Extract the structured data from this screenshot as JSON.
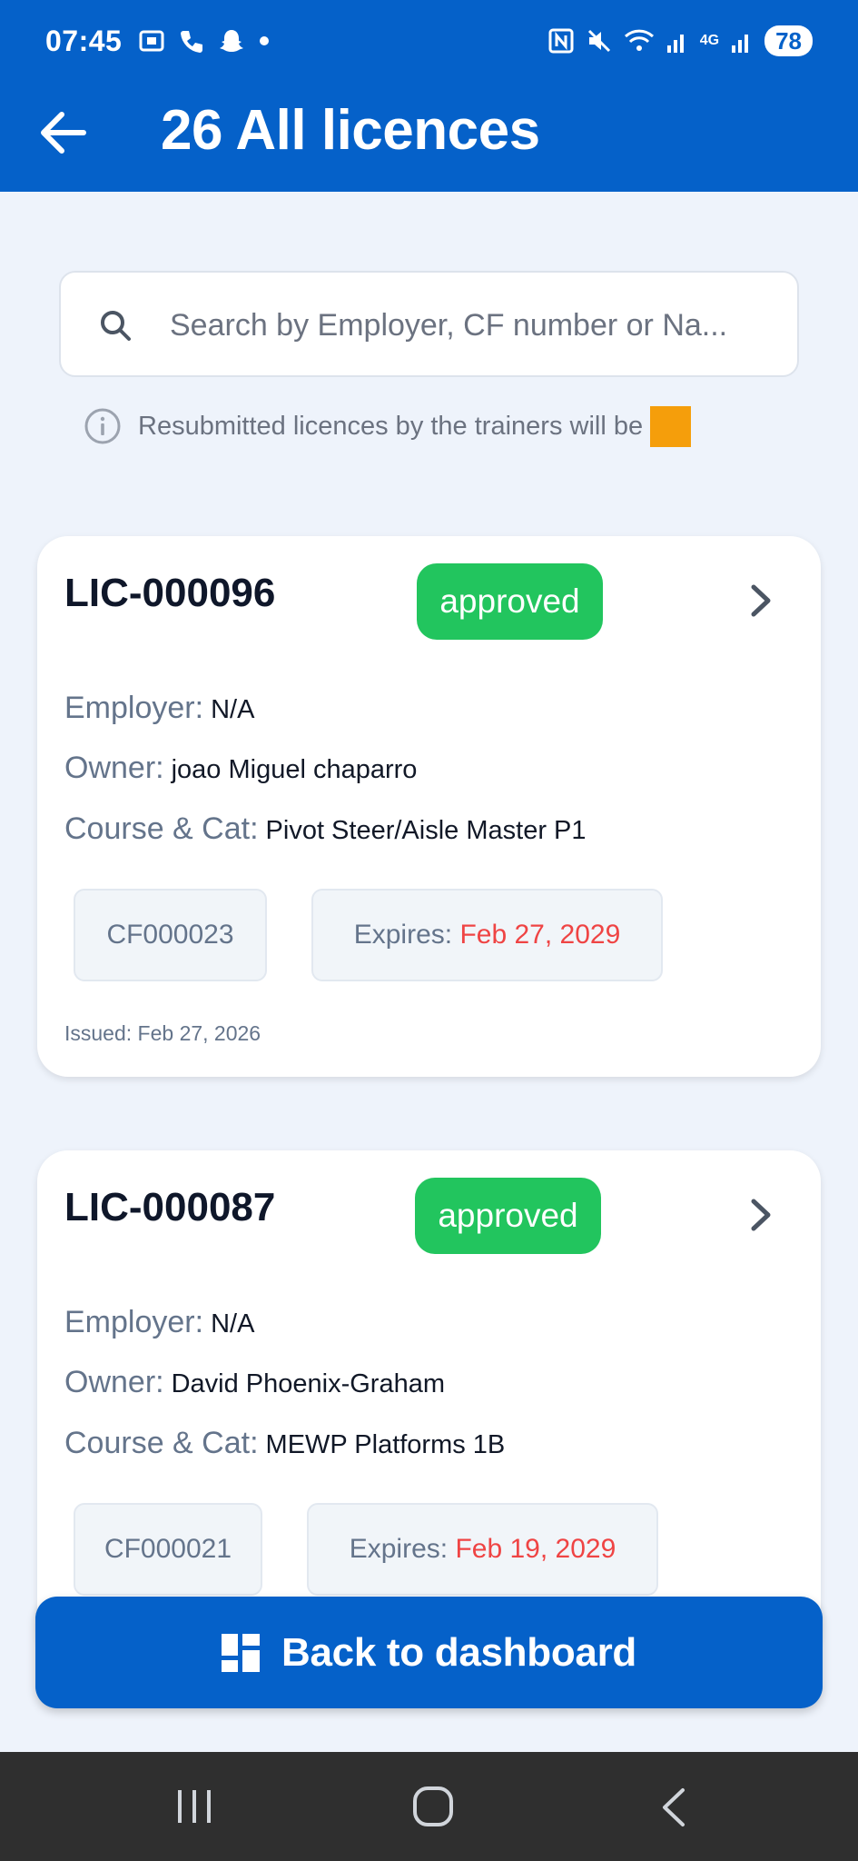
{
  "status_bar": {
    "time": "07:45",
    "battery": "78",
    "network": "4G"
  },
  "header": {
    "title": "26 All licences",
    "back_icon": "arrow-left-icon"
  },
  "search": {
    "placeholder": "Search by Employer, CF number or Na...",
    "value": ""
  },
  "info": {
    "text": "Resubmitted licences by the trainers will be",
    "swatch_color": "#f59e0b"
  },
  "labels": {
    "employer": "Employer:",
    "owner": "Owner:",
    "course": "Course & Cat:",
    "expires": "Expires:"
  },
  "licences": [
    {
      "id": "LIC-000096",
      "status": "approved",
      "employer": "N/A",
      "owner": "joao Miguel chaparro",
      "course": "Pivot Steer/Aisle Master P1",
      "cf_number": "CF000023",
      "expires": "Feb 27, 2029",
      "issued": "Issued: Feb 27, 2026"
    },
    {
      "id": "LIC-000087",
      "status": "approved",
      "employer": "N/A",
      "owner": "David Phoenix-Graham",
      "course": "MEWP Platforms 1B",
      "cf_number": "CF000021",
      "expires": "Feb 19, 2029"
    }
  ],
  "footer": {
    "dashboard_button": "Back to dashboard"
  },
  "colors": {
    "primary": "#0561c9",
    "approved": "#22c55e",
    "expiry": "#ef4444"
  }
}
